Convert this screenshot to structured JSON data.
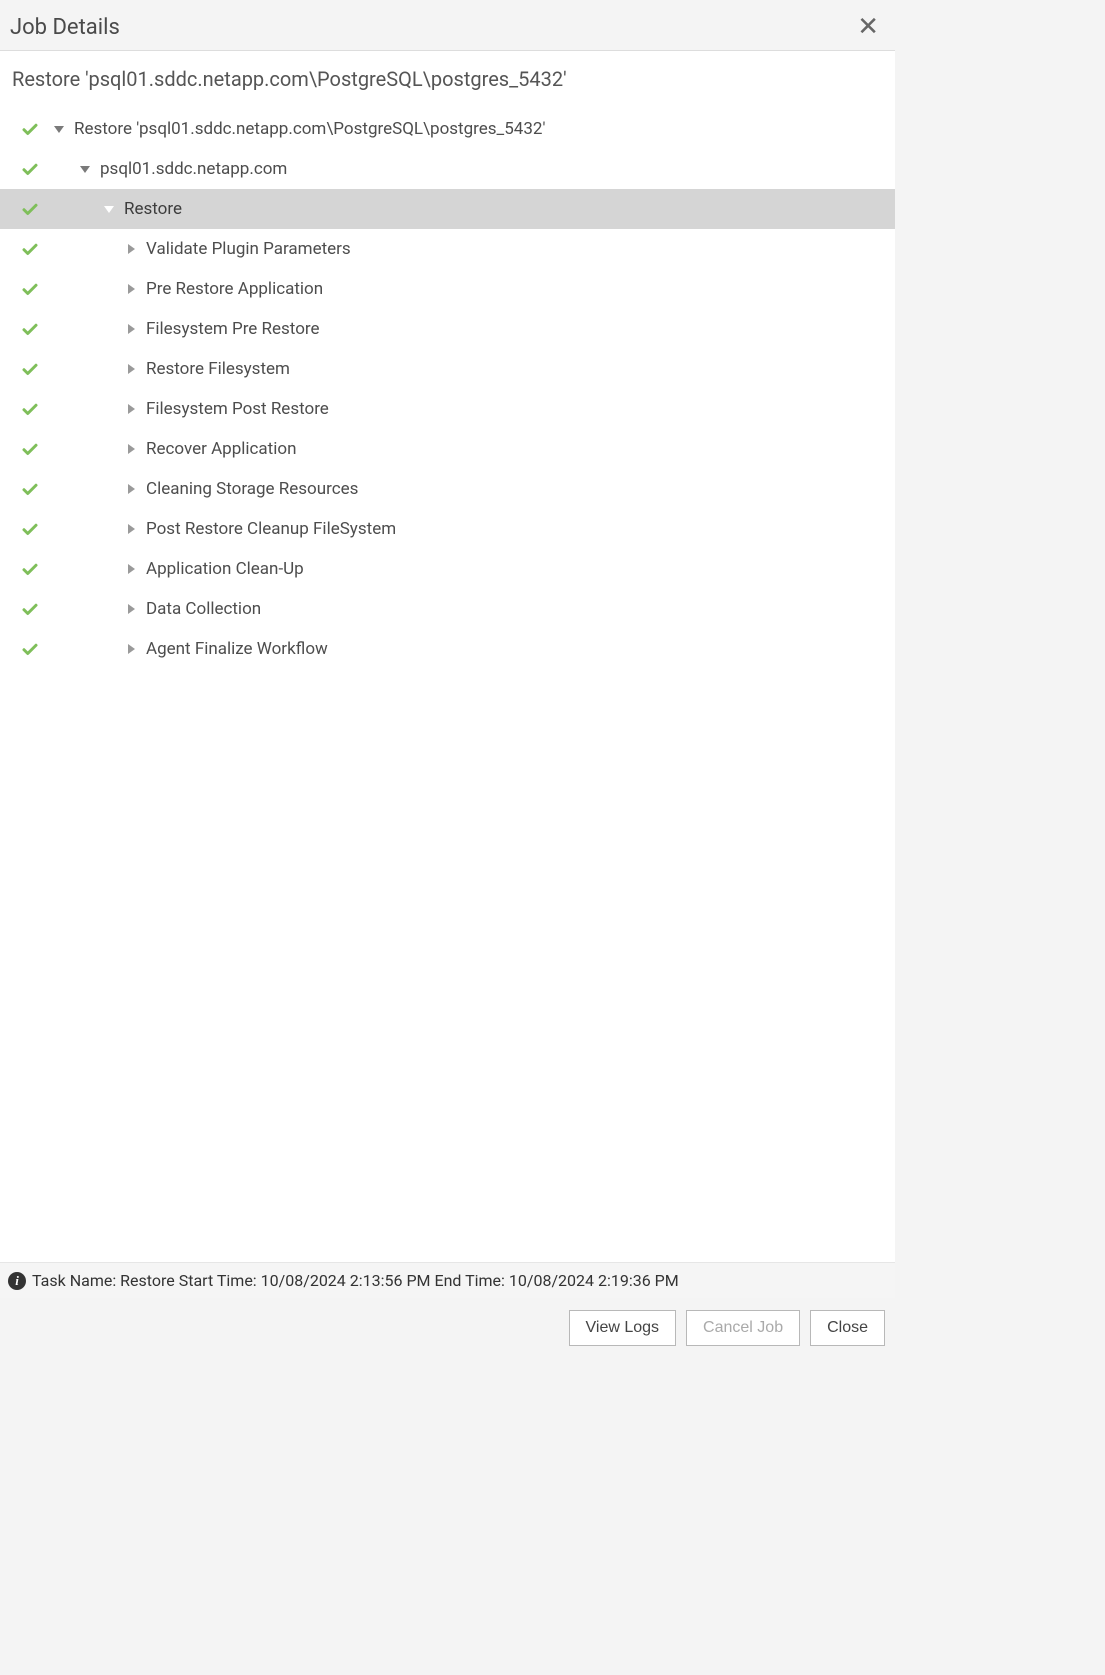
{
  "header": {
    "title": "Job Details"
  },
  "subtitle": "Restore 'psql01.sddc.netapp.com\\PostgreSQL\\postgres_5432'",
  "tree": {
    "root": {
      "label": "Restore 'psql01.sddc.netapp.com\\PostgreSQL\\postgres_5432'",
      "expanded": true,
      "status": "success",
      "selected": false,
      "indent": 0
    },
    "host": {
      "label": "psql01.sddc.netapp.com",
      "expanded": true,
      "status": "success",
      "selected": false,
      "indent": 1
    },
    "restore": {
      "label": "Restore",
      "expanded": true,
      "status": "success",
      "selected": true,
      "indent": 2
    },
    "steps": [
      {
        "label": "Validate Plugin Parameters",
        "status": "success",
        "expanded": false,
        "indent": 3
      },
      {
        "label": "Pre Restore Application",
        "status": "success",
        "expanded": false,
        "indent": 3
      },
      {
        "label": "Filesystem Pre Restore",
        "status": "success",
        "expanded": false,
        "indent": 3
      },
      {
        "label": "Restore Filesystem",
        "status": "success",
        "expanded": false,
        "indent": 3
      },
      {
        "label": "Filesystem Post Restore",
        "status": "success",
        "expanded": false,
        "indent": 3
      },
      {
        "label": "Recover Application",
        "status": "success",
        "expanded": false,
        "indent": 3
      },
      {
        "label": "Cleaning Storage Resources",
        "status": "success",
        "expanded": false,
        "indent": 3
      },
      {
        "label": "Post Restore Cleanup FileSystem",
        "status": "success",
        "expanded": false,
        "indent": 3
      },
      {
        "label": "Application Clean-Up",
        "status": "success",
        "expanded": false,
        "indent": 3
      },
      {
        "label": "Data Collection",
        "status": "success",
        "expanded": false,
        "indent": 3
      },
      {
        "label": "Agent Finalize Workflow",
        "status": "success",
        "expanded": false,
        "indent": 3
      }
    ]
  },
  "status_bar": {
    "text": "Task Name: Restore Start Time: 10/08/2024 2:13:56 PM End Time: 10/08/2024 2:19:36 PM"
  },
  "footer": {
    "view_logs": "View Logs",
    "cancel_job": "Cancel Job",
    "close": "Close"
  }
}
